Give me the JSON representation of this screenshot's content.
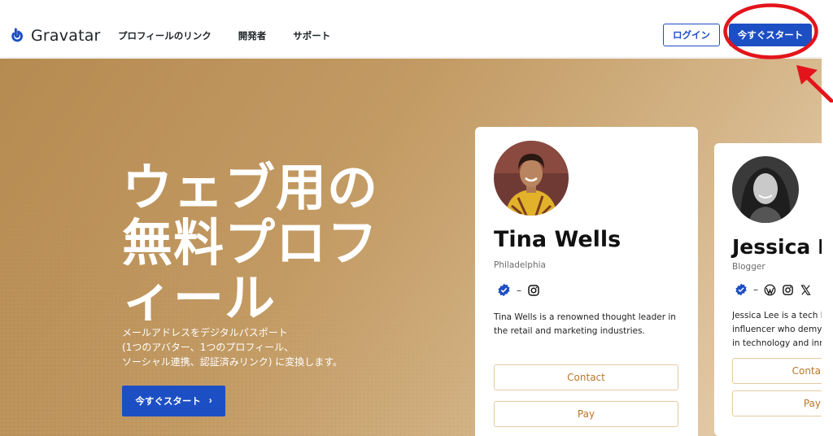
{
  "header": {
    "logo_text": "Gravatar",
    "nav": [
      "プロフィールのリンク",
      "開発者",
      "サポート"
    ],
    "login_label": "ログイン",
    "start_label": "今すぐスタート"
  },
  "hero": {
    "title_lines": [
      "ウェブ用の",
      "無料プロフ",
      "ィール"
    ],
    "subtitle_lines": [
      "メールアドレスをデジタルパスポート",
      "(1つのアバター、1つのプロフィール、",
      "ソーシャル連携、認証済みリンク) に変換します。"
    ],
    "cta_label": "今すぐスタート",
    "cta_arrow": "›"
  },
  "cards": [
    {
      "name": "Tina Wells",
      "location": "Philadelphia",
      "bio_lines": [
        "Tina Wells is a renowned thought leader in",
        "the retail and marketing industries."
      ],
      "buttons": [
        "Contact",
        "Pay"
      ],
      "icons": [
        "verified-icon",
        "instagram-icon"
      ]
    },
    {
      "name": "Jessica L",
      "location": "Blogger",
      "bio_lines": [
        "Jessica Lee is a tech blog",
        "influencer who demystifi",
        "in technology and innova"
      ],
      "buttons": [
        "Conta",
        "Pay"
      ],
      "icons": [
        "verified-icon",
        "wordpress-icon",
        "instagram-icon",
        "x-icon"
      ]
    }
  ],
  "colors": {
    "brand_blue": "#1d4fc4",
    "annotation_red": "#e3141b",
    "button_text_orange": "#b8762a"
  }
}
